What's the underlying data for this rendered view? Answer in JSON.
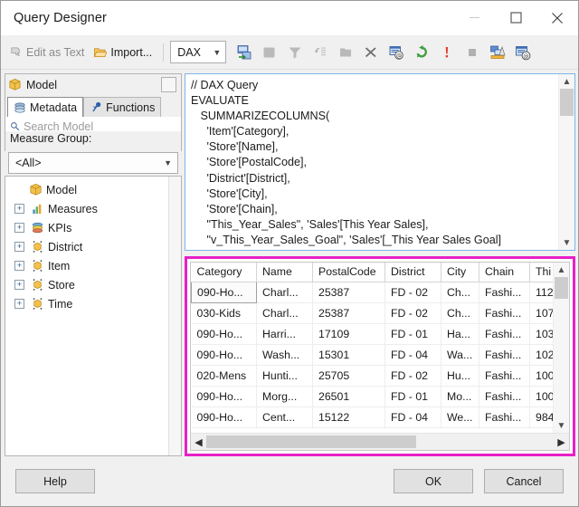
{
  "window": {
    "title": "Query Designer",
    "controls": {
      "minimize": "minimize-button",
      "maximize": "maximize-button",
      "close": "close-button"
    }
  },
  "toolbar": {
    "edit_as_text": "Edit as Text",
    "import": "Import...",
    "language": "DAX",
    "icons": [
      "add-dataset-icon",
      "cube-icon",
      "filter-icon",
      "auto-detect-icon",
      "delete-group-icon",
      "delete-icon",
      "edit-as-text-query-icon",
      "refresh-fields-icon",
      "run-query-icon",
      "stop-icon",
      "design-mode-icon",
      "query-parameters-icon"
    ]
  },
  "left_panel": {
    "header": "Model",
    "tabs": [
      {
        "label": "Metadata",
        "icon": "metadata-icon",
        "active": true
      },
      {
        "label": "Functions",
        "icon": "functions-icon",
        "active": false
      }
    ],
    "search_placeholder": "Search Model",
    "measure_group_label": "Measure Group:",
    "measure_group_value": "<All>",
    "tree": [
      {
        "label": "Model",
        "icon": "cube-icon",
        "expandable": false,
        "level": 0
      },
      {
        "label": "Measures",
        "icon": "measures-icon",
        "expandable": true,
        "level": 1
      },
      {
        "label": "KPIs",
        "icon": "kpis-icon",
        "expandable": true,
        "level": 1
      },
      {
        "label": "District",
        "icon": "dimension-icon",
        "expandable": true,
        "level": 1
      },
      {
        "label": "Item",
        "icon": "dimension-icon",
        "expandable": true,
        "level": 1
      },
      {
        "label": "Store",
        "icon": "dimension-icon",
        "expandable": true,
        "level": 1
      },
      {
        "label": "Time",
        "icon": "dimension-icon",
        "expandable": true,
        "level": 1
      }
    ]
  },
  "query": {
    "text": "// DAX Query\nEVALUATE\n   SUMMARIZECOLUMNS(\n     'Item'[Category],\n     'Store'[Name],\n     'Store'[PostalCode],\n     'District'[District],\n     'Store'[City],\n     'Store'[Chain],\n     \"This_Year_Sales\", 'Sales'[This Year Sales],\n     \"v_This_Year_Sales_Goal\", 'Sales'[_This Year Sales Goal]"
  },
  "results": {
    "highlight_color": "#e81fc8",
    "columns": [
      "Category",
      "Name",
      "PostalCode",
      "District",
      "City",
      "Chain",
      "Thi"
    ],
    "rows": [
      [
        "090-Ho...",
        "Charl...",
        "25387",
        "FD - 02",
        "Ch...",
        "Fashi...",
        "112"
      ],
      [
        "030-Kids",
        "Charl...",
        "25387",
        "FD - 02",
        "Ch...",
        "Fashi...",
        "107"
      ],
      [
        "090-Ho...",
        "Harri...",
        "17109",
        "FD - 01",
        "Ha...",
        "Fashi...",
        "103"
      ],
      [
        "090-Ho...",
        "Wash...",
        "15301",
        "FD - 04",
        "Wa...",
        "Fashi...",
        "102"
      ],
      [
        "020-Mens",
        "Hunti...",
        "25705",
        "FD - 02",
        "Hu...",
        "Fashi...",
        "100"
      ],
      [
        "090-Ho...",
        "Morg...",
        "26501",
        "FD - 01",
        "Mo...",
        "Fashi...",
        "100"
      ],
      [
        "090-Ho...",
        "Cent...",
        "15122",
        "FD - 04",
        "We...",
        "Fashi...",
        "984"
      ]
    ],
    "selected_cell": {
      "row": 0,
      "col": 0
    }
  },
  "footer": {
    "help": "Help",
    "ok": "OK",
    "cancel": "Cancel"
  }
}
